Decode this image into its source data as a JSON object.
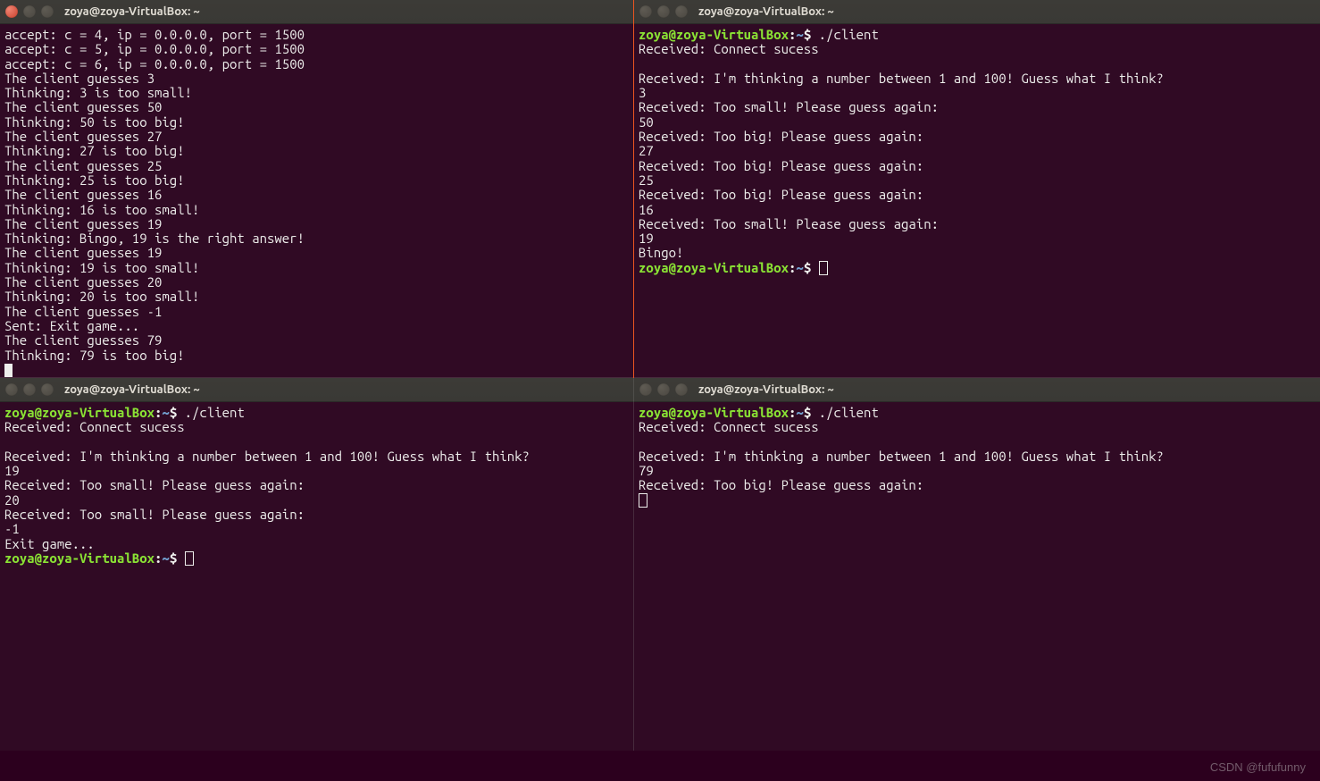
{
  "windowTitle": "zoya@zoya-VirtualBox: ~",
  "prompt": {
    "user": "zoya@zoya-VirtualBox",
    "colon": ":",
    "path": "~",
    "dollar": "$ "
  },
  "watermark": "CSDN @fufufunny",
  "panes": {
    "tl": {
      "active": true,
      "lines": [
        "accept: c = 4, ip = 0.0.0.0, port = 1500",
        "accept: c = 5, ip = 0.0.0.0, port = 1500",
        "accept: c = 6, ip = 0.0.0.0, port = 1500",
        "The client guesses 3",
        "Thinking: 3 is too small!",
        "The client guesses 50",
        "Thinking: 50 is too big!",
        "The client guesses 27",
        "Thinking: 27 is too big!",
        "The client guesses 25",
        "Thinking: 25 is too big!",
        "The client guesses 16",
        "Thinking: 16 is too small!",
        "The client guesses 19",
        "Thinking: Bingo, 19 is the right answer!",
        "The client guesses 19",
        "Thinking: 19 is too small!",
        "The client guesses 20",
        "Thinking: 20 is too small!",
        "The client guesses -1",
        "Sent: Exit game...",
        "The client guesses 79",
        "Thinking: 79 is too big!"
      ]
    },
    "tr": {
      "cmd": "./client",
      "lines": [
        "Received: Connect sucess",
        "",
        "Received: I'm thinking a number between 1 and 100! Guess what I think?",
        "3",
        "Received: Too small! Please guess again:",
        "50",
        "Received: Too big! Please guess again:",
        "27",
        "Received: Too big! Please guess again:",
        "25",
        "Received: Too big! Please guess again:",
        "16",
        "Received: Too small! Please guess again:",
        "19",
        "Bingo!"
      ]
    },
    "bl": {
      "cmd": "./client",
      "lines": [
        "Received: Connect sucess",
        "",
        "Received: I'm thinking a number between 1 and 100! Guess what I think?",
        "19",
        "Received: Too small! Please guess again:",
        "20",
        "Received: Too small! Please guess again:",
        "-1",
        "Exit game..."
      ]
    },
    "br": {
      "cmd": "./client",
      "lines": [
        "Received: Connect sucess",
        "",
        "Received: I'm thinking a number between 1 and 100! Guess what I think?",
        "79",
        "Received: Too big! Please guess again:"
      ]
    }
  }
}
